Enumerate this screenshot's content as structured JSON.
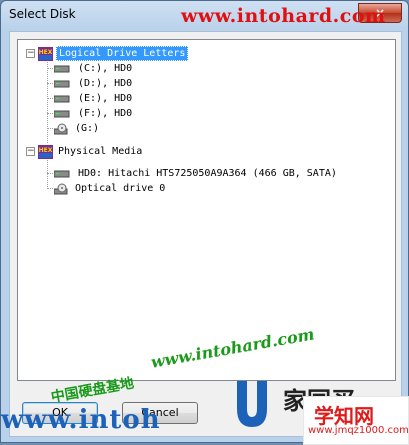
{
  "window": {
    "title": "Select Disk",
    "close_symbol": "×"
  },
  "watermarks": {
    "top": "www.intohard.com",
    "middle": "www.intohard.com",
    "chinese": "中国硬盘基地",
    "bottom": "www.intoh",
    "brand_cn": "家园买",
    "badge_cn": "学知网",
    "badge_url": "www.jmqz1000.com"
  },
  "tree": {
    "logical": {
      "label": "Logical Drive Letters",
      "expander": "−",
      "icon": "hex-editor-icon",
      "items": [
        {
          "label": "(C:), HD0",
          "icon": "hard-drive-icon"
        },
        {
          "label": "(D:), HD0",
          "icon": "hard-drive-icon"
        },
        {
          "label": "(E:), HD0",
          "icon": "hard-drive-icon"
        },
        {
          "label": "(F:), HD0",
          "icon": "hard-drive-icon"
        },
        {
          "label": "(G:)",
          "icon": "optical-drive-icon"
        }
      ]
    },
    "physical": {
      "label": "Physical Media",
      "expander": "−",
      "icon": "hex-editor-icon",
      "items": [
        {
          "label": "HD0: Hitachi HTS725050A9A364 (466 GB, SATA)",
          "icon": "hard-drive-icon"
        },
        {
          "label": "Optical drive 0",
          "icon": "optical-drive-icon"
        }
      ]
    }
  },
  "buttons": {
    "ok": "OK",
    "cancel": "Cancel"
  },
  "colors": {
    "selection": "#3399ff",
    "watermark_red": "#e01010",
    "watermark_green": "#1a9a1a",
    "brand_blue": "#1c62b9"
  }
}
